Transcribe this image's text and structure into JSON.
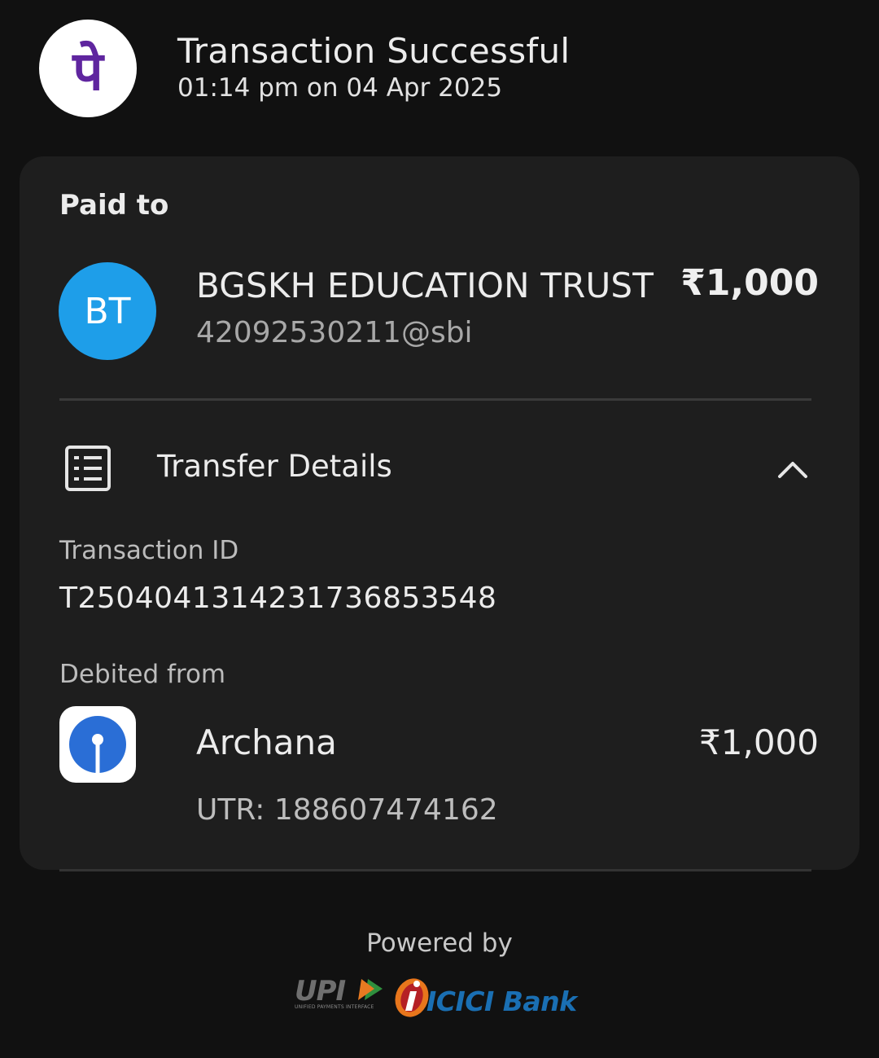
{
  "header": {
    "title": "Transaction Successful",
    "timestamp": "01:14 pm on 04 Apr 2025",
    "app_logo_glyph": "पे",
    "app_logo_color": "#5f259f"
  },
  "paid_to": {
    "section_label": "Paid to",
    "avatar_initials": "BT",
    "avatar_color": "#1e9ee9",
    "name": "BGSKH EDUCATION TRUST",
    "upi_id": "42092530211@sbi",
    "amount": "₹1,000"
  },
  "transfer_details": {
    "label": "Transfer Details",
    "icon": "receipt-list-icon",
    "toggle_icon": "chevron-up-icon",
    "transaction_id_label": "Transaction ID",
    "transaction_id": "T2504041314231736853548",
    "debited_from_label": "Debited from",
    "bank_icon": "sbi-bank-icon",
    "account_name": "Archana",
    "amount": "₹1,000",
    "utr": "UTR: 188607474162"
  },
  "footer": {
    "powered_by": "Powered by",
    "upi_logo_text": "UPI",
    "upi_tagline": "UNIFIED PAYMENTS INTERFACE",
    "bank_logo_text": "ICICI Bank"
  }
}
